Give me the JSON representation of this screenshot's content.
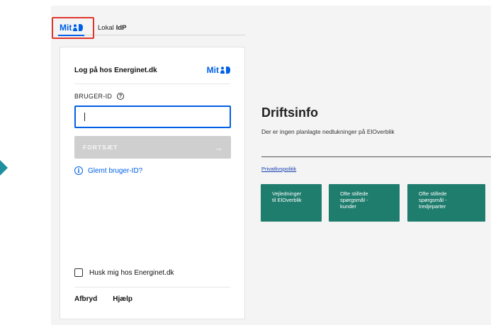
{
  "tabs": {
    "mitid_logo": "Mit",
    "lokal_label": "Lokal",
    "lokal_bold": "IdP"
  },
  "card": {
    "title": "Log på hos Energinet.dk",
    "logo_text": "Mit",
    "field_label": "BRUGER-ID",
    "help_symbol": "?",
    "input_value": "",
    "continue_label": "FORTSÆT",
    "continue_arrow": "→",
    "forgot_icon": "i",
    "forgot_label": "Glemt bruger-ID?",
    "remember_label": "Husk mig hos Energinet.dk",
    "cancel_label": "Afbryd",
    "help_label": "Hjælp"
  },
  "drift": {
    "title": "Driftsinfo",
    "message": "Der er ingen planlagte nedlukninger på ElOverblik",
    "privacy_label": "Privatlivspolitik"
  },
  "tiles": [
    {
      "line1": "Vejledninger",
      "line2": "til ElOverblik",
      "line3": ""
    },
    {
      "line1": "Ofte stillede",
      "line2": "spørgsmål -",
      "line3": "kunder"
    },
    {
      "line1": "Ofte stillede",
      "line2": "spørgsmål -",
      "line3": "tredjeparter"
    }
  ],
  "colors": {
    "mitid_blue": "#0060e6",
    "tile_green": "#1f7d6e",
    "highlight_red": "#e0352b"
  }
}
